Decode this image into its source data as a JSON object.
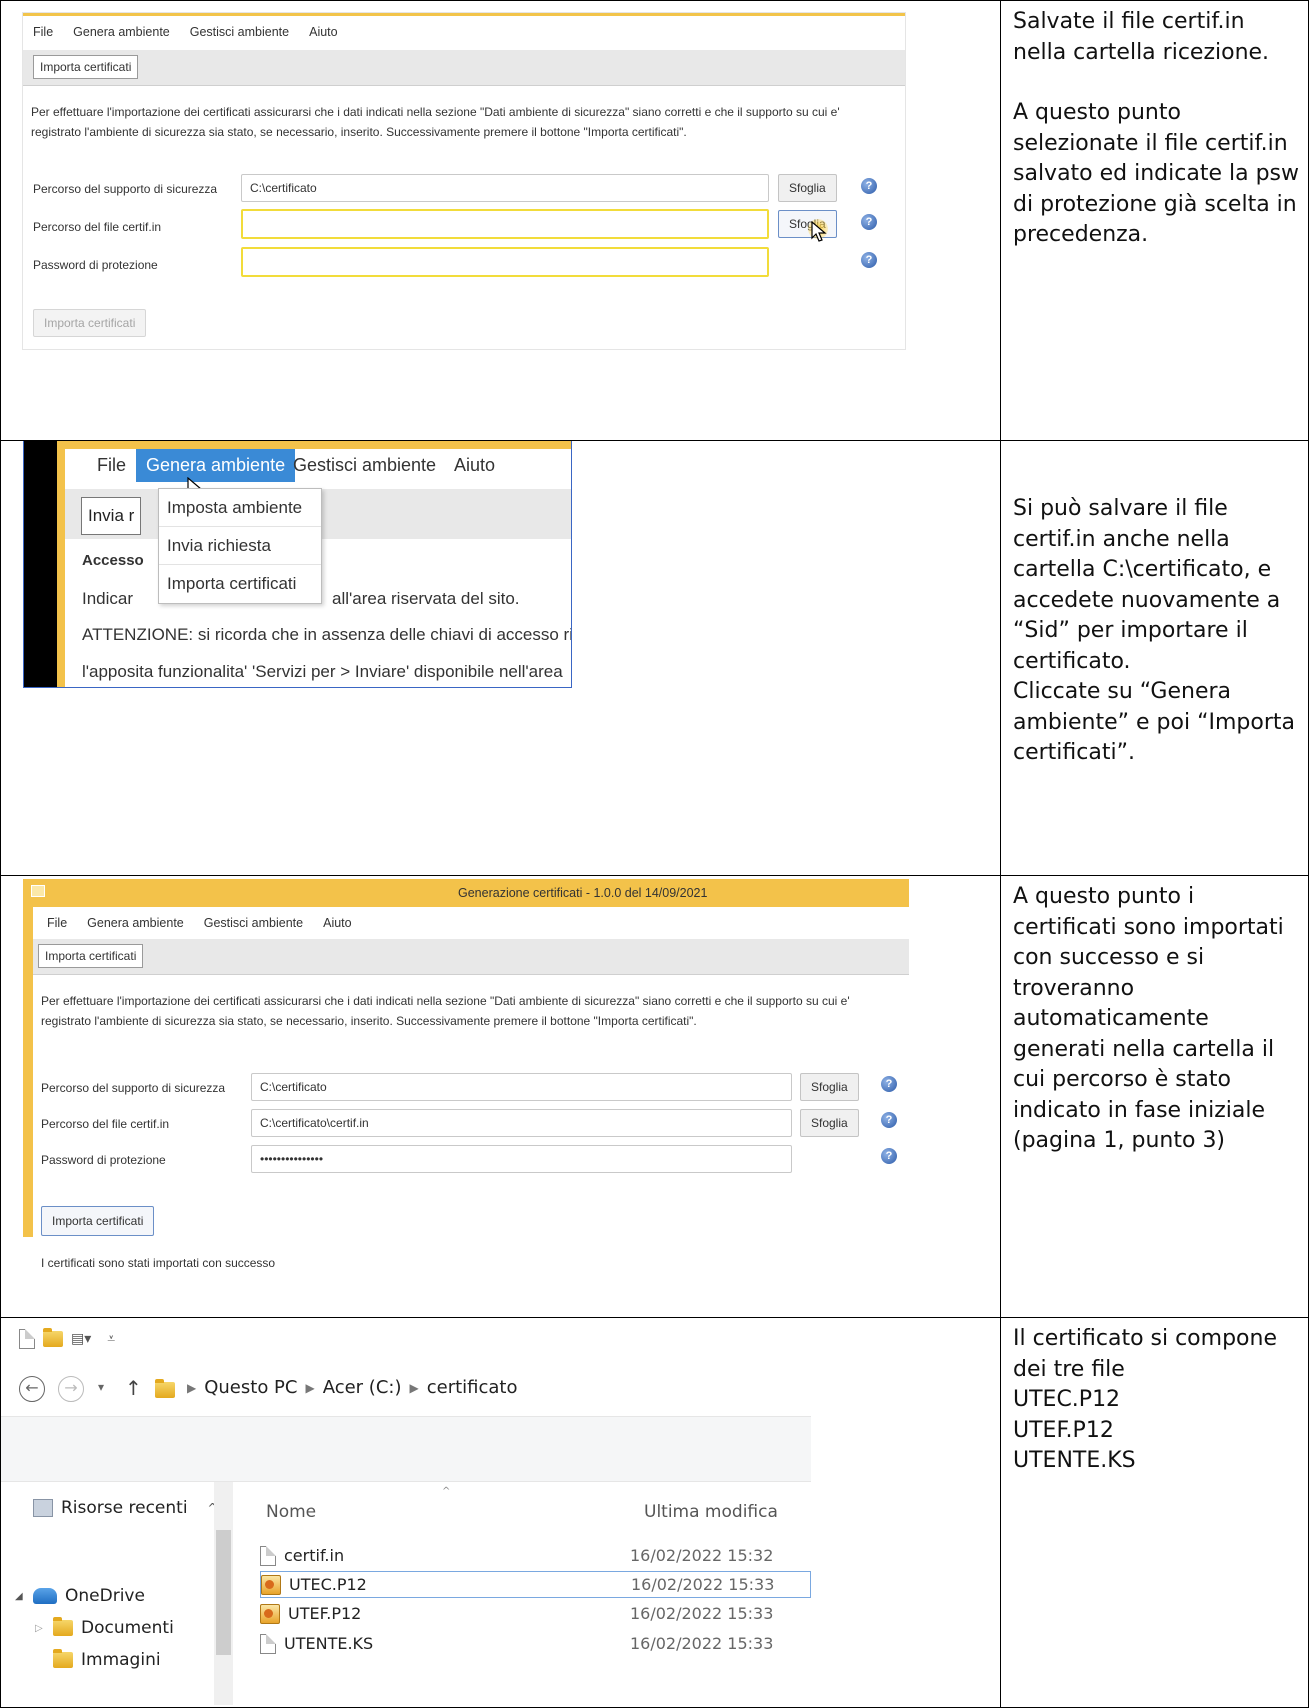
{
  "step1": {
    "menu": [
      "File",
      "Genera ambiente",
      "Gestisci ambiente",
      "Aiuto"
    ],
    "tab": "Importa certificati",
    "description": "Per effettuare l'importazione dei certificati assicurarsi che i dati indicati nella sezione \"Dati ambiente di sicurezza\" siano corretti e che il supporto su cui e' registrato l'ambiente di sicurezza sia stato, se necessario, inserito. Successivamente premere il bottone \"Importa certificati\".",
    "fields": [
      {
        "label": "Percorso del supporto di sicurezza",
        "value": "C:\\certificato",
        "button": "Sfoglia"
      },
      {
        "label": "Percorso del file certif.in",
        "value": "",
        "button": "Sfoglia"
      },
      {
        "label": "Password di protezione",
        "value": ""
      }
    ],
    "import_button": "Importa certificati",
    "text_a": "Salvate il file certif.in nella cartella ricezione.",
    "text_b": "A questo punto selezionate il file certif.in salvato ed indicate la psw di protezione già scelta in precedenza."
  },
  "step2": {
    "menu": [
      "File",
      "Genera ambiente",
      "Gestisci ambiente",
      "Aiuto"
    ],
    "tab_partial": "Invia r",
    "dropdown": [
      "Imposta ambiente",
      "Invia richiesta",
      "Importa certificati"
    ],
    "lines": [
      "Accesso",
      "Indicar",
      "all'area riservata del sito.",
      "ATTENZIONE: si ricorda che in assenza delle chiavi di accesso rila",
      "l'apposita funzionalita' 'Servizi per > Inviare' disponibile nell'area"
    ],
    "text": "Si può salvare il file certif.in anche nella cartella C:\\certificato, e accedete nuovamente a “Sid” per importare il certificato.\nCliccate su “Genera ambiente” e poi “Importa certificati”."
  },
  "step3": {
    "window_title": "Generazione certificati - 1.0.0 del 14/09/2021",
    "menu": [
      "File",
      "Genera ambiente",
      "Gestisci ambiente",
      "Aiuto"
    ],
    "tab": "Importa certificati",
    "description": "Per effettuare l'importazione dei certificati assicurarsi che i dati indicati nella sezione \"Dati ambiente di sicurezza\" siano corretti e che il supporto su cui e' registrato l'ambiente di sicurezza sia stato, se necessario, inserito. Successivamente premere il bottone \"Importa certificati\".",
    "fields": [
      {
        "label": "Percorso del supporto di sicurezza",
        "value": "C:\\certificato",
        "button": "Sfoglia"
      },
      {
        "label": "Percorso del file certif.in",
        "value": "C:\\certificato\\certif.in",
        "button": "Sfoglia"
      },
      {
        "label": "Password di protezione",
        "value": "•••••••••••••••"
      }
    ],
    "import_button": "Importa certificati",
    "success": "I certificati sono stati importati con successo",
    "text": "A questo punto i certificati sono importati con successo e si troveranno automaticamente generati nella cartella il cui percorso è stato indicato in fase iniziale (pagina 1, punto 3)"
  },
  "step4": {
    "breadcrumb": [
      "Questo PC",
      "Acer (C:)",
      "certificato"
    ],
    "tree": [
      "Risorse recenti",
      "OneDrive",
      "Documenti",
      "Immagini"
    ],
    "columns": {
      "name": "Nome",
      "modified": "Ultima modifica"
    },
    "files": [
      {
        "name": "certif.in",
        "modified": "16/02/2022 15:32"
      },
      {
        "name": "UTEC.P12",
        "modified": "16/02/2022 15:33"
      },
      {
        "name": "UTEF.P12",
        "modified": "16/02/2022 15:33"
      },
      {
        "name": "UTENTE.KS",
        "modified": "16/02/2022 15:33"
      }
    ],
    "text": "Il certificato si compone dei tre file\nUTEC.P12\nUTEF.P12\nUTENTE.KS"
  },
  "icons": {
    "help": "help-icon",
    "cursor": "mouse-pointer-icon",
    "folder": "folder-icon",
    "file": "file-icon",
    "certificate": "certificate-file-icon"
  },
  "colors": {
    "app_accent": "#f3c24a",
    "field_highlight": "#f2dc3a",
    "menu_selected": "#3a8ad6",
    "help_icon": "#2b5aa8"
  }
}
